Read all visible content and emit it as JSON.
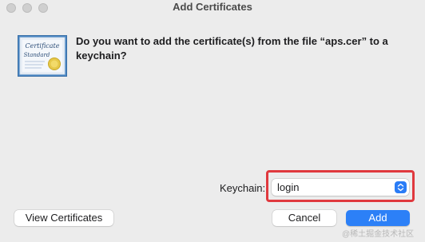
{
  "window": {
    "title": "Add Certificates"
  },
  "dialog": {
    "message": "Do you want to add the certificate(s) from the file “aps.cer” to a keychain?",
    "icon": "certificate-icon"
  },
  "keychain": {
    "label": "Keychain:",
    "selected": "login"
  },
  "buttons": {
    "view_certificates": "View Certificates",
    "cancel": "Cancel",
    "add": "Add"
  },
  "watermark": "@稀土掘金技术社区",
  "colors": {
    "accent": "#2c80f7",
    "highlight": "#e0393e"
  }
}
